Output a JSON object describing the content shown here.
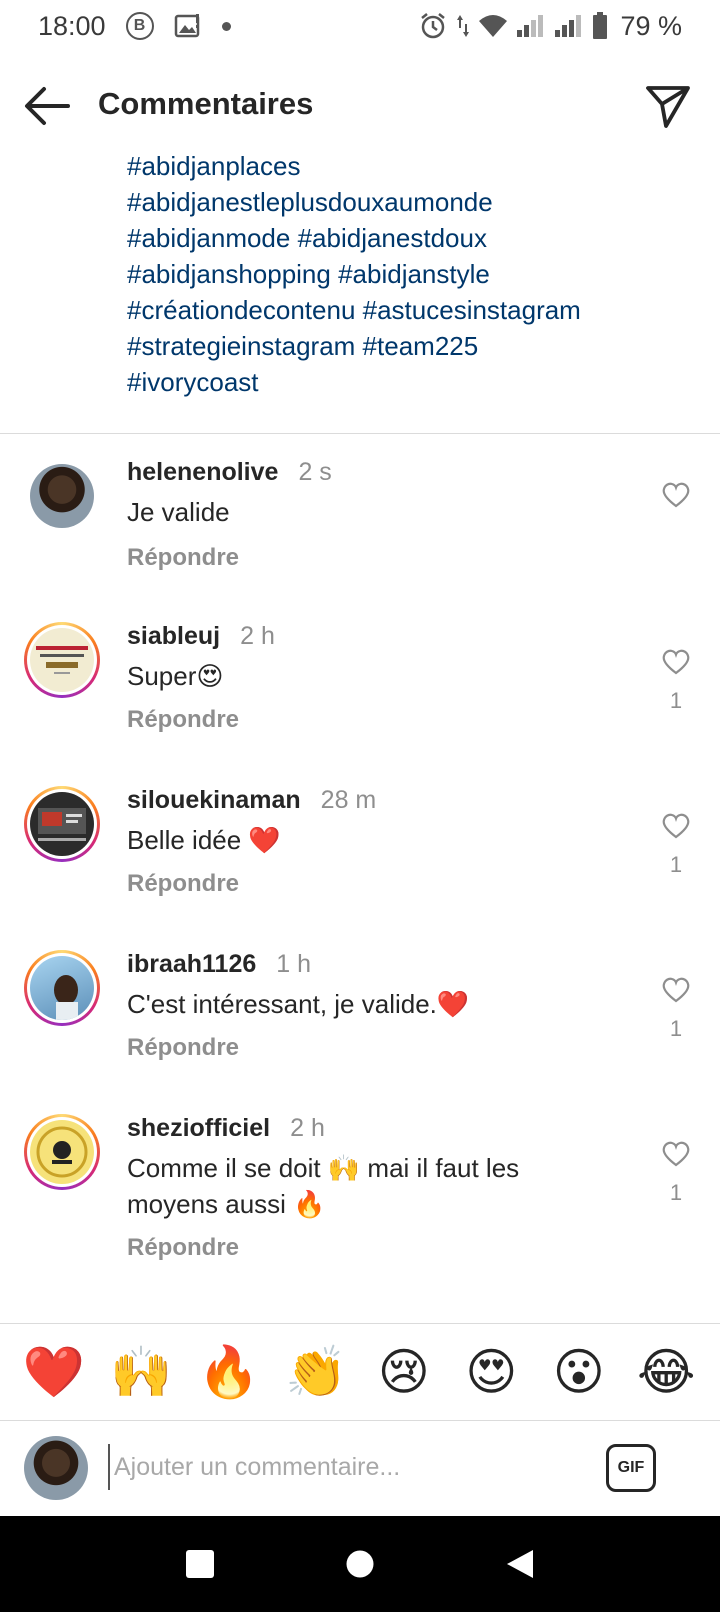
{
  "status_bar": {
    "time": "18:00",
    "b_label": "B",
    "battery": "79 %"
  },
  "header": {
    "title": "Commentaires"
  },
  "caption": {
    "hashtags": [
      "#abidjanplaces",
      "#abidjanestleplusdouxaumonde",
      "#abidjanmode #abidjanestdoux",
      "#abidjanshopping #abidjanstyle",
      "#créationdecontenu #astucesinstagram",
      "#strategieinstagram #team225",
      "#ivorycoast"
    ]
  },
  "comments": [
    {
      "username": "helenenolive",
      "time": "2 s",
      "text": "Je valide",
      "reply": "Répondre",
      "likes": ""
    },
    {
      "username": "siableuj",
      "time": "2 h",
      "text": "Super😍",
      "reply": "Répondre",
      "likes": "1"
    },
    {
      "username": "silouekinaman",
      "time": "28 m",
      "text": "Belle idée ❤️",
      "reply": "Répondre",
      "likes": "1"
    },
    {
      "username": "ibraah1126",
      "time": "1 h",
      "text": "C'est intéressant, je valide.❤️",
      "reply": "Répondre",
      "likes": "1"
    },
    {
      "username": "sheziofficiel",
      "time": "2 h",
      "text": "Comme il se doit 🙌 mai il faut les moyens aussi 🔥",
      "reply": "Répondre",
      "likes": "1"
    }
  ],
  "emoji_bar": [
    "❤️",
    "🙌",
    "🔥",
    "👏",
    "😢",
    "😍",
    "😮",
    "😂"
  ],
  "input": {
    "placeholder": "Ajouter un commentaire...",
    "gif_label": "GIF"
  },
  "colors": {
    "hashtag": "#00376b",
    "muted": "#8e8e8e",
    "text": "#262626"
  }
}
